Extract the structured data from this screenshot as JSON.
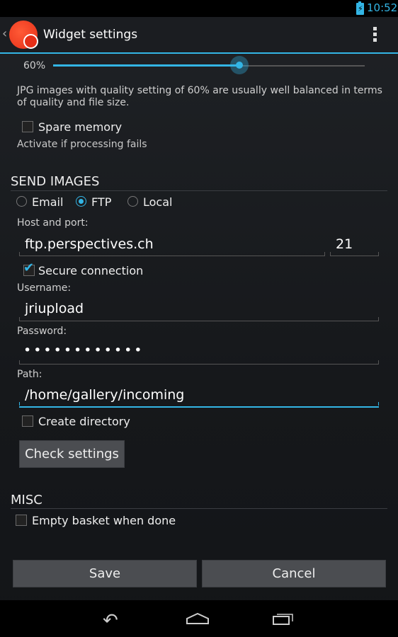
{
  "status_bar": {
    "time": "10:52",
    "battery_glyph": "⚡"
  },
  "action_bar": {
    "title": "Widget settings",
    "up_caret": "‹"
  },
  "quality": {
    "label": "60%",
    "value_percent": 60,
    "description": "JPG images with quality setting of 60% are usually well balanced in terms of quality and file size."
  },
  "spare_memory": {
    "label": "Spare memory",
    "checked": false,
    "hint": "Activate if processing fails"
  },
  "send_images": {
    "title": "SEND IMAGES",
    "options": [
      {
        "label": "Email",
        "selected": false
      },
      {
        "label": "FTP",
        "selected": true
      },
      {
        "label": "Local",
        "selected": false
      }
    ],
    "host_label": "Host and port:",
    "host_value": "ftp.perspectives.ch",
    "port_value": "21",
    "secure_label": "Secure connection",
    "secure_checked": true,
    "username_label": "Username:",
    "username_value": "jriupload",
    "password_label": "Password:",
    "password_value": "••••••••••••",
    "path_label": "Path:",
    "path_value": "/home/gallery/incoming",
    "create_dir_label": "Create directory",
    "create_dir_checked": false,
    "check_button": "Check settings"
  },
  "misc": {
    "title": "MISC",
    "empty_basket_label": "Empty basket when done",
    "empty_basket_checked": false
  },
  "footer": {
    "save": "Save",
    "cancel": "Cancel"
  },
  "nav": {
    "back_glyph": "↶"
  },
  "colors": {
    "accent": "#33b5e5"
  }
}
